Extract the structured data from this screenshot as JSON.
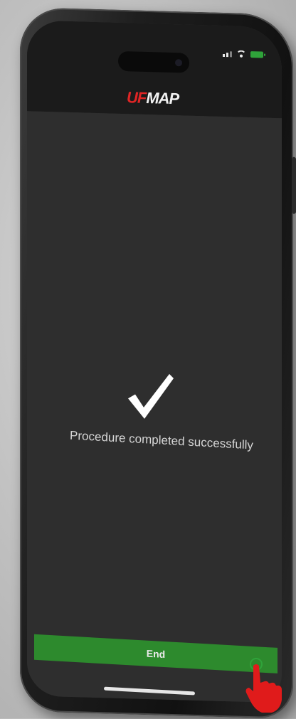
{
  "app": {
    "logo_part1": "UF",
    "logo_part2": "MAP"
  },
  "screen": {
    "message": "Procedure completed successfully",
    "end_label": "End"
  },
  "colors": {
    "accent_green": "#2d8a2d",
    "logo_red": "#e02525",
    "screen_bg": "#2e2e2e"
  },
  "icons": {
    "check": "checkmark-icon",
    "pointer": "hand-pointer-icon"
  }
}
